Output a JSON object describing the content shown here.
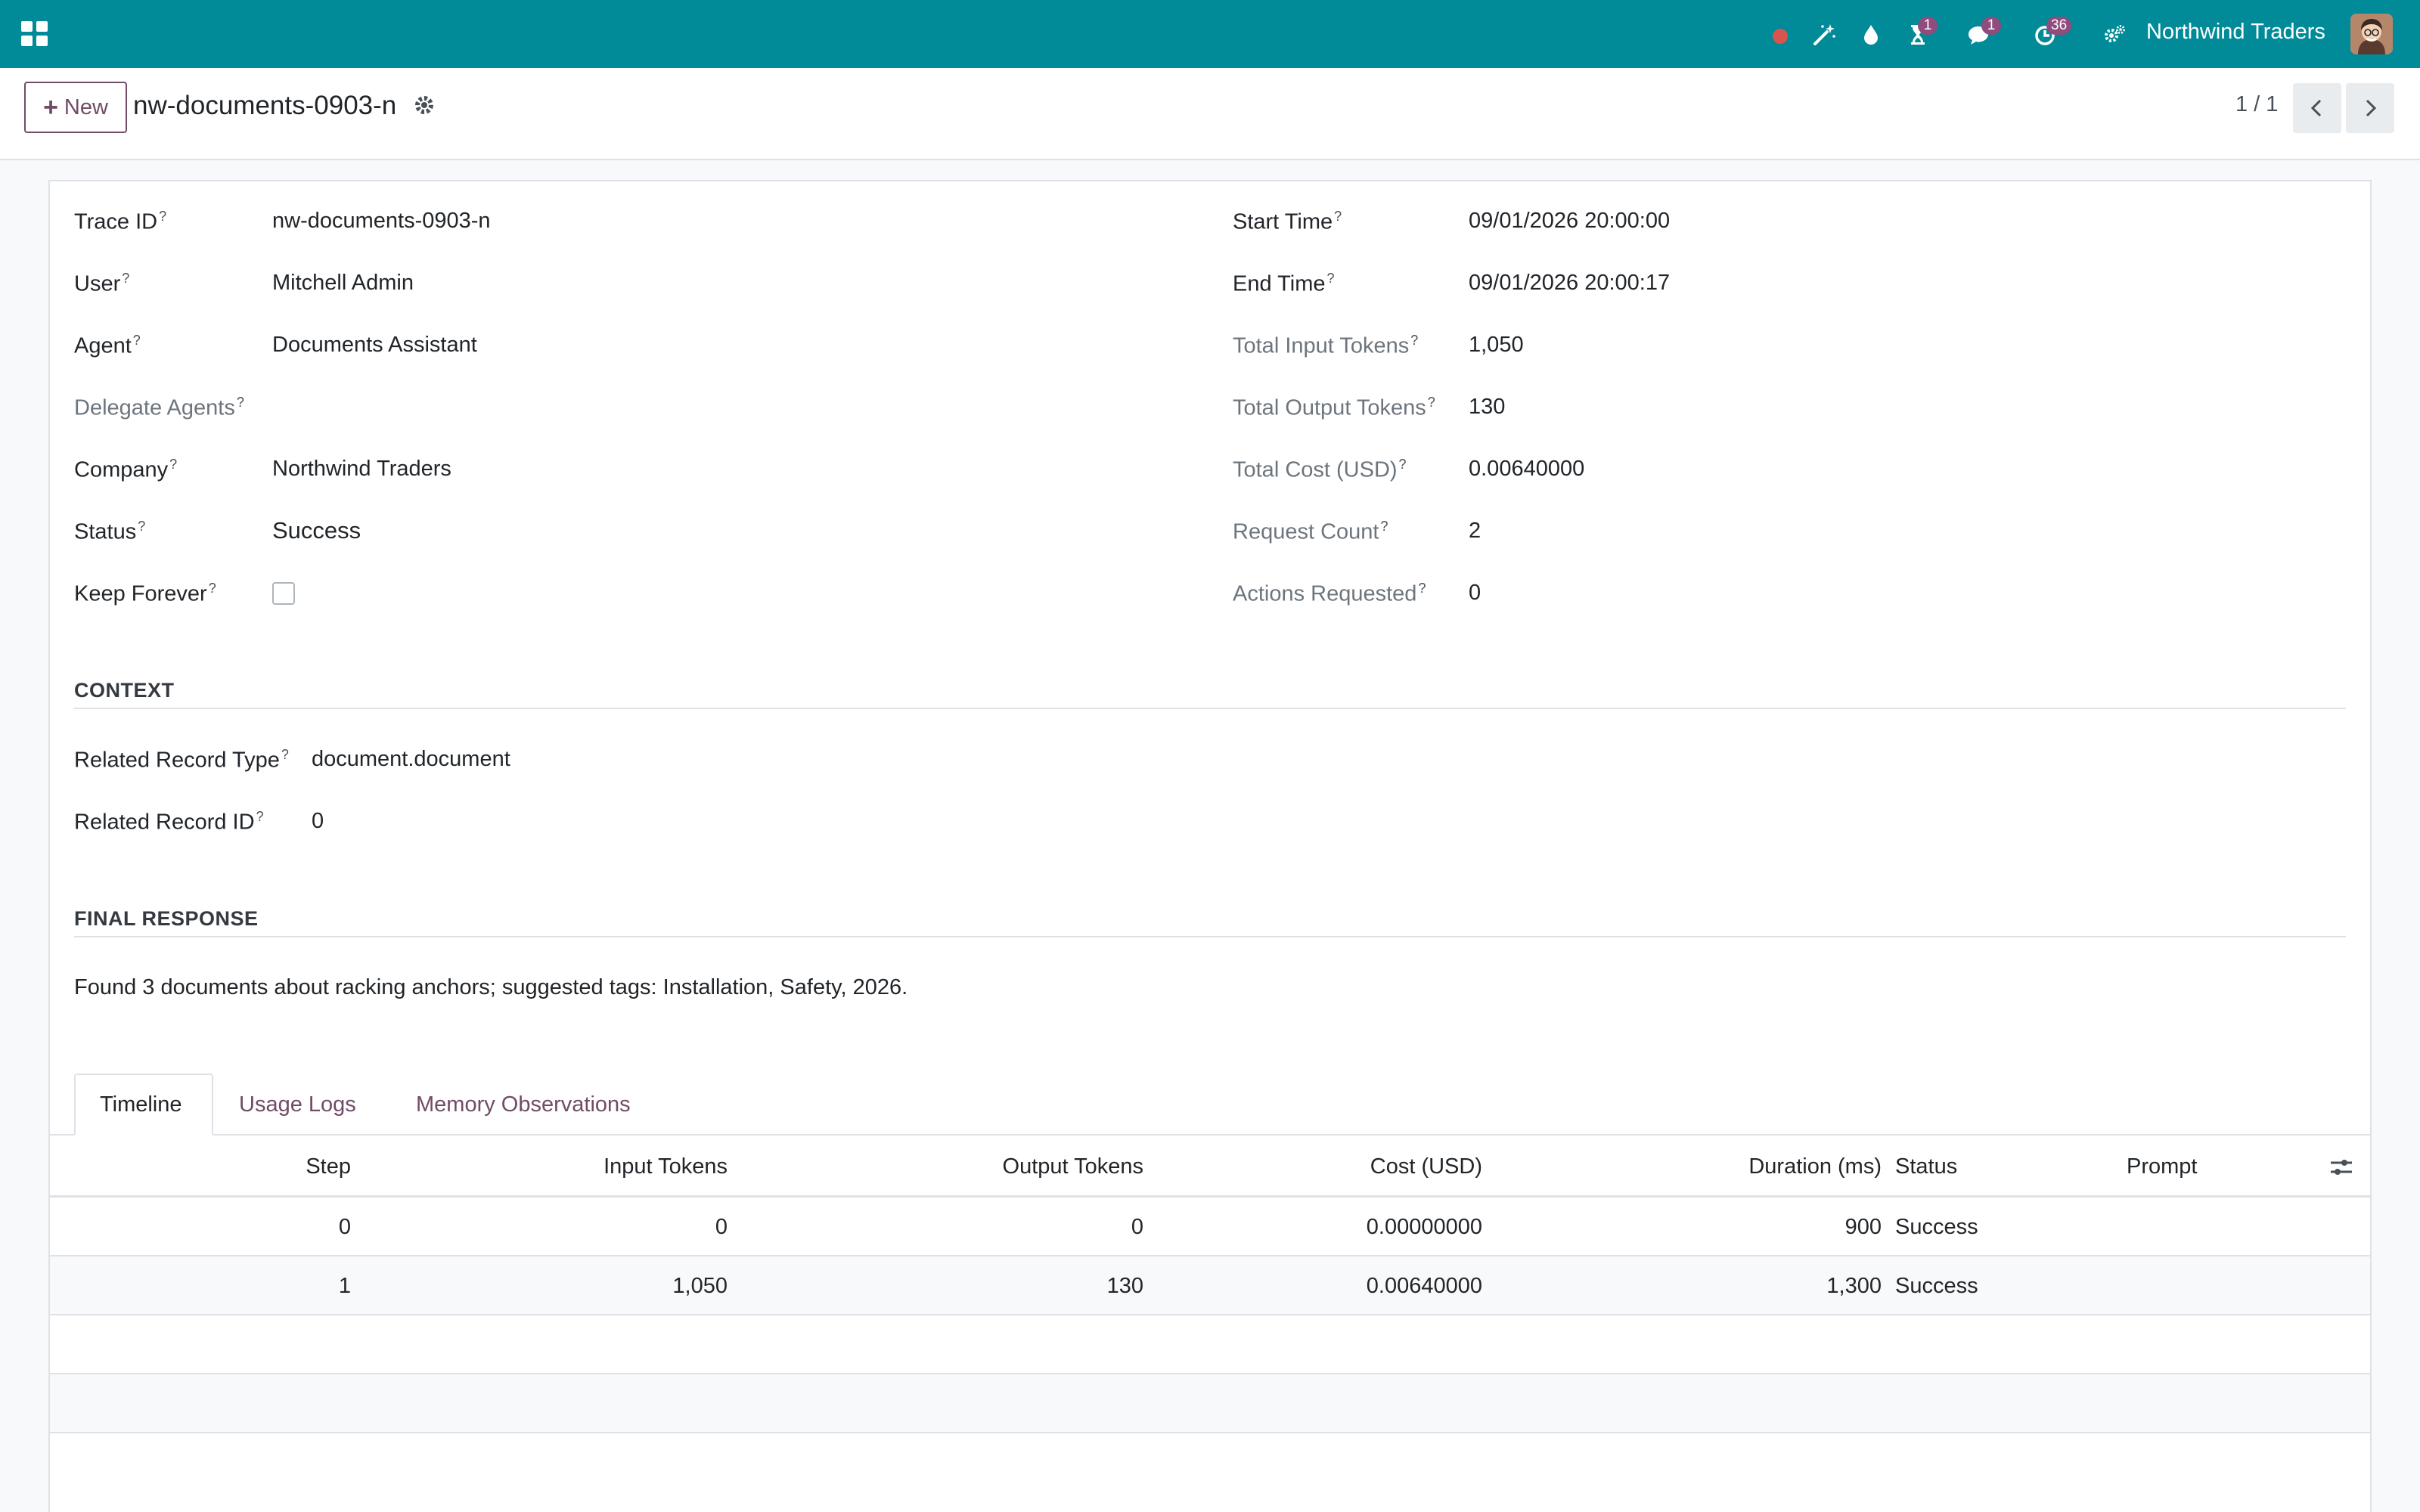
{
  "navbar": {
    "company": "Northwind Traders",
    "badges": {
      "activities": "1",
      "messages": "1",
      "timer": "36"
    },
    "icons": [
      "apps-icon",
      "record-dot-icon",
      "magic-wand-icon",
      "drop-icon",
      "hourglass-icon",
      "chat-icon",
      "clock-icon",
      "settings-icon"
    ]
  },
  "control_panel": {
    "new_label": "New",
    "record_title": "nw-documents-0903-n",
    "pager": "1 / 1"
  },
  "form": {
    "left": [
      {
        "label": "Trace ID",
        "value": "nw-documents-0903-n",
        "muted": false
      },
      {
        "label": "User",
        "value": "Mitchell Admin",
        "muted": false
      },
      {
        "label": "Agent",
        "value": "Documents Assistant",
        "muted": false
      },
      {
        "label": "Delegate Agents",
        "value": "",
        "muted": true
      },
      {
        "label": "Company",
        "value": "Northwind Traders",
        "muted": false
      },
      {
        "label": "Status",
        "value": "Success",
        "muted": false
      },
      {
        "label": "Keep Forever",
        "value": "",
        "muted": false
      }
    ],
    "right": [
      {
        "label": "Start Time",
        "value": "09/01/2026 20:00:00",
        "muted": false
      },
      {
        "label": "End Time",
        "value": "09/01/2026 20:00:17",
        "muted": false
      },
      {
        "label": "Total Input Tokens",
        "value": "1,050",
        "muted": true
      },
      {
        "label": "Total Output Tokens",
        "value": "130",
        "muted": true
      },
      {
        "label": "Total Cost (USD)",
        "value": "0.00640000",
        "muted": true
      },
      {
        "label": "Request Count",
        "value": "2",
        "muted": true
      },
      {
        "label": "Actions Requested",
        "value": "0",
        "muted": true
      }
    ],
    "tooltip_mark": "?",
    "keep_forever_checked": false
  },
  "context": {
    "title": "CONTEXT",
    "related_record_type_label": "Related Record Type",
    "related_record_type": "document.document",
    "related_record_id_label": "Related Record ID",
    "related_record_id": "0"
  },
  "final_response": {
    "title": "FINAL RESPONSE",
    "text": "Found 3 documents about racking anchors; suggested tags: Installation, Safety, 2026."
  },
  "tabs": [
    {
      "label": "Timeline",
      "active": true
    },
    {
      "label": "Usage Logs",
      "active": false
    },
    {
      "label": "Memory Observations",
      "active": false
    }
  ],
  "timeline": {
    "columns": [
      "Step",
      "Input Tokens",
      "Output Tokens",
      "Cost (USD)",
      "Duration (ms)",
      "Status",
      "Prompt"
    ],
    "rows": [
      [
        "0",
        "0",
        "0",
        "0.00000000",
        "900",
        "Success",
        ""
      ],
      [
        "1",
        "1,050",
        "130",
        "0.00640000",
        "1,300",
        "Success",
        ""
      ]
    ]
  },
  "colors": {
    "navbar": "#018a98",
    "primary": "#714b67",
    "badge": "#8f4c7d",
    "record_dot": "#d9534f"
  }
}
